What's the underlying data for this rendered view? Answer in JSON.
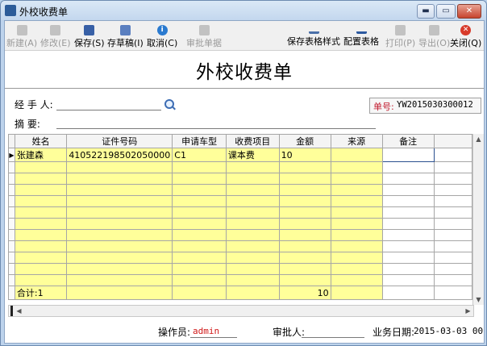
{
  "window": {
    "title": "外校收费单",
    "min_label": "▬",
    "max_label": "▭",
    "close_label": "✕"
  },
  "toolbar": {
    "new": "新建(A)",
    "edit": "修改(E)",
    "save": "保存(S)",
    "draft": "存草稿(I)",
    "cancel": "取消(C)",
    "audit": "审批单据",
    "save_table_style": "保存表格样式",
    "config_table": "配置表格",
    "print": "打印(P)",
    "export": "导出(O)",
    "close": "关闭(Q)"
  },
  "form": {
    "heading": "外校收费单",
    "handler_label": "经 手 人:",
    "handler_value": "",
    "summary_label": "摘    要:",
    "summary_value": "",
    "bill_no_label": "单号:",
    "bill_no_value": "YW2015030300012"
  },
  "grid": {
    "columns": [
      "姓名",
      "证件号码",
      "申请车型",
      "收费项目",
      "金额",
      "来源",
      "备注"
    ],
    "rows": [
      [
        "张建森",
        "410522198502050000",
        "C1",
        "课本费",
        "10",
        "",
        ""
      ]
    ],
    "summary": {
      "label": "合计:1",
      "amount": "10"
    }
  },
  "footer": {
    "operator_label": "操作员:",
    "operator_value": "admin",
    "approver_label": "审批人:",
    "approver_value": "",
    "date_label": "业务日期:",
    "date_value": "2015-03-03 00"
  },
  "colors": {
    "grid_fill": "#ffff9a",
    "bill_label": "#c0182b",
    "operator": "#d01818"
  }
}
